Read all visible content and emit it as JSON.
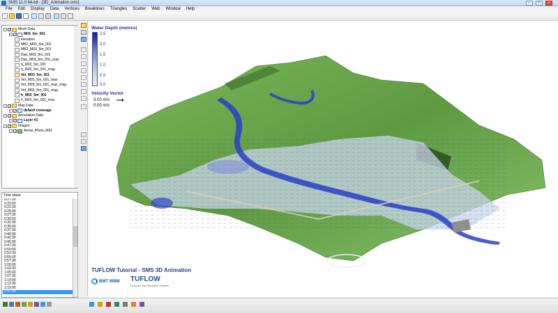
{
  "window": {
    "title": "SMS 11.0 64-bit - [3D_Animation.sms]",
    "controls": [
      "–",
      "□",
      "×"
    ]
  },
  "menu": [
    "File",
    "Edit",
    "Display",
    "Data",
    "Vertices",
    "Breaklines",
    "Triangles",
    "Scatter",
    "Web",
    "Window",
    "Help"
  ],
  "tree": [
    {
      "depth": 0,
      "icon": "folder",
      "label": "Mesh Data",
      "check": true,
      "bold": false
    },
    {
      "depth": 1,
      "icon": "mesh",
      "label": "M03_5m_001",
      "check": true,
      "bold": true
    },
    {
      "depth": 2,
      "icon": "z",
      "label": "elevation",
      "check": false,
      "bold": false
    },
    {
      "depth": 2,
      "icon": "mb",
      "label": "MB1_M03_5m_001",
      "check": false,
      "bold": false
    },
    {
      "depth": 2,
      "icon": "mb",
      "label": "MB2_M03_5m_001",
      "check": false,
      "bold": false
    },
    {
      "depth": 2,
      "icon": "dep",
      "label": "Dep_M03_5m_001",
      "check": false,
      "bold": false
    },
    {
      "depth": 2,
      "icon": "dep",
      "label": "Dep_M03_5m_001_max",
      "check": false,
      "bold": false
    },
    {
      "depth": 2,
      "icon": "q",
      "label": "q_M03_5m_001",
      "check": false,
      "bold": false
    },
    {
      "depth": 2,
      "icon": "q",
      "label": "q_M03_5m_001_mag",
      "check": false,
      "bold": false
    },
    {
      "depth": 2,
      "icon": "vec",
      "label": "Vel_M03_5m_001",
      "check": false,
      "bold": true
    },
    {
      "depth": 2,
      "icon": "vel",
      "label": "Vel_M03_5m_001_max",
      "check": false,
      "bold": false
    },
    {
      "depth": 2,
      "icon": "vel",
      "label": "Vel_M03_5m_001_max_mag",
      "check": false,
      "bold": false
    },
    {
      "depth": 2,
      "icon": "vel",
      "label": "Vel_M03_5m_001_mag",
      "check": false,
      "bold": false
    },
    {
      "depth": 2,
      "icon": "h",
      "label": "h_M03_5m_001",
      "check": false,
      "bold": true
    },
    {
      "depth": 2,
      "icon": "h",
      "label": "h_M03_5m_001_max",
      "check": false,
      "bold": false
    },
    {
      "depth": 0,
      "icon": "folder",
      "label": "Map Data",
      "check": true,
      "bold": false
    },
    {
      "depth": 1,
      "icon": "layer",
      "label": "default coverage",
      "check": true,
      "bold": true
    },
    {
      "depth": 0,
      "icon": "folder",
      "label": "Annotation Data",
      "check": true,
      "bold": false
    },
    {
      "depth": 1,
      "icon": "layer",
      "label": "Layer #1",
      "check": true,
      "bold": true
    },
    {
      "depth": 0,
      "icon": "folder",
      "label": "Images",
      "check": true,
      "bold": false
    },
    {
      "depth": 1,
      "icon": "photo",
      "label": "Aerial_Photo_M01",
      "check": true,
      "bold": false
    }
  ],
  "timesteps": {
    "header": "Time steps:",
    "items": [
      "0:17:30",
      "0:20:00",
      "0:22:30",
      "0:25:00",
      "0:27:30",
      "0:30:00",
      "0:32:30",
      "0:35:00",
      "0:37:30",
      "0:40:00",
      "0:42:30",
      "0:45:00",
      "0:47:30",
      "0:50:00",
      "0:52:30",
      "0:55:00",
      "0:57:30",
      "1:00:00",
      "1:02:30",
      "1:05:00",
      "1:07:30",
      "1:10:00",
      "1:12:30",
      "1:15:00",
      "1:17:30"
    ],
    "selected": "1:17:30"
  },
  "legend": {
    "depth_title": "Water Depth (metres)",
    "depth_ticks": [
      "2.5",
      "2.0",
      "1.5",
      "1.0",
      "0.5",
      "0.0"
    ],
    "velocity_title": "Velocity Vector",
    "velocity_labels": [
      "3.00 m/s",
      "0.00 m/s"
    ]
  },
  "caption": {
    "title": "TUFLOW Tutorial - SMS 3D Animation",
    "bmt": "BMT WBM",
    "tuflow": "TUFLOW",
    "tuflow_sub": "Flood and Tide Simulation Software"
  },
  "colors": {
    "depth_max": "#1010b0",
    "depth_min": "#e8eef8",
    "terrain": "#6aa84f",
    "accent_text": "#2a2aa0"
  }
}
